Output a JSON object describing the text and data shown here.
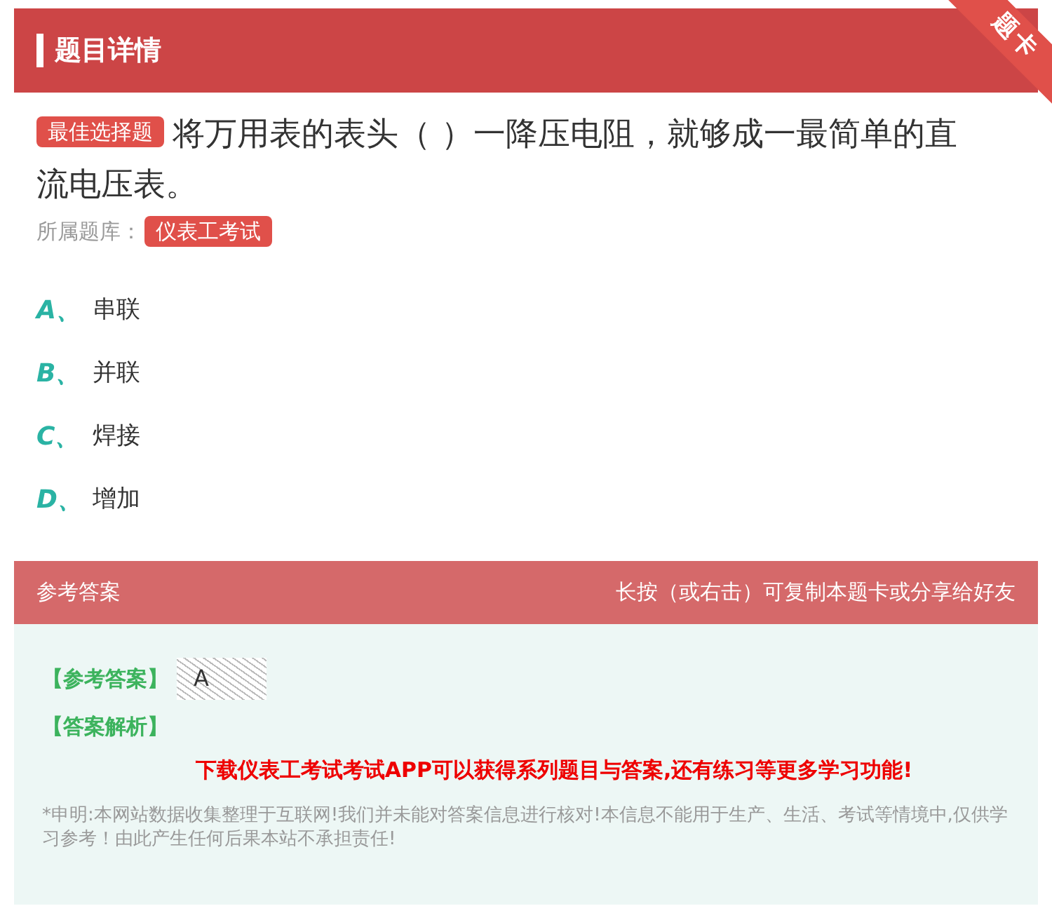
{
  "header": {
    "title": "题目详情",
    "corner_badge": "题卡"
  },
  "question": {
    "type_tag": "最佳选择题",
    "text": "将万用表的表头（ ）一降压电阻，就够成一最简单的直流电压表。",
    "bank_label": "所属题库：",
    "bank_tag": "仪表工考试"
  },
  "options": [
    {
      "letter": "A、",
      "text": "串联"
    },
    {
      "letter": "B、",
      "text": "并联"
    },
    {
      "letter": "C、",
      "text": "焊接"
    },
    {
      "letter": "D、",
      "text": "增加"
    }
  ],
  "answer_bar": {
    "title": "参考答案",
    "hint": "长按（或右击）可复制本题卡或分享给好友"
  },
  "answer": {
    "label": "【参考答案】",
    "value": "A",
    "analysis_label": "【答案解析】",
    "promo": "下载仪表工考试考试APP可以获得系列题目与答案,还有练习等更多学习功能!",
    "disclaimer": "*申明:本网站数据收集整理于互联网!我们并未能对答案信息进行核对!本信息不能用于生产、生活、考试等情境中,仅供学习参考！由此产生任何后果本站不承担责任!"
  }
}
